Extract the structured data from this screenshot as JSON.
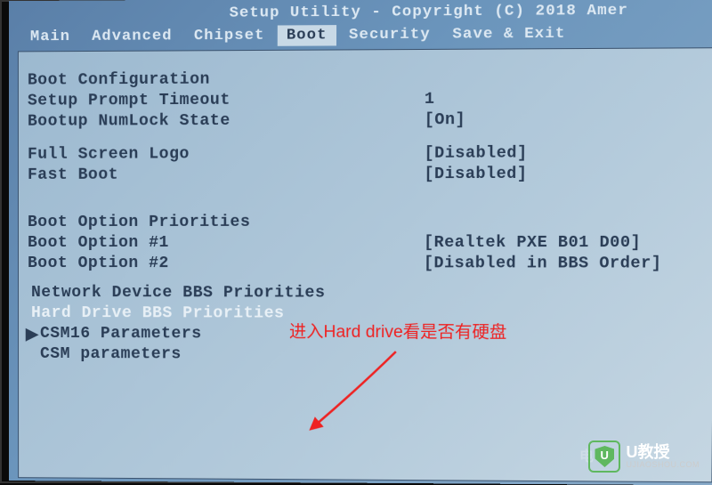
{
  "title_fragment": "Setup Utility - Copyright (C) 2018 Amer",
  "menu": {
    "items": [
      "Main",
      "Advanced",
      "Chipset",
      "Boot",
      "Security",
      "Save & Exit"
    ],
    "active_index": 3
  },
  "sections": {
    "boot_config": {
      "header": "Boot Configuration",
      "setup_prompt_label": "Setup Prompt Timeout",
      "setup_prompt_value": "1",
      "numlock_label": "Bootup NumLock State",
      "numlock_value": "[On]"
    },
    "display": {
      "full_screen_label": "Full Screen Logo",
      "full_screen_value": "[Disabled]",
      "fast_boot_label": "Fast Boot",
      "fast_boot_value": "[Disabled]"
    },
    "priorities": {
      "header": "Boot Option Priorities",
      "opt1_label": "Boot Option #1",
      "opt1_value": "[Realtek PXE B01 D00]",
      "opt2_label": "Boot Option #2",
      "opt2_value": "[Disabled in BBS Order]"
    },
    "sub_items": {
      "network": "Network Device BBS Priorities",
      "harddrive": "Hard Drive BBS Priorities",
      "csm16": "CSM16 Parameters",
      "csm": "CSM parameters"
    }
  },
  "selected_item": "harddrive",
  "cursor_char": "▶",
  "annotation_text": "进入Hard drive看是否有硬盘",
  "watermark": {
    "brand": "U教授",
    "sub": "UJIAOSHOU.COM",
    "faint": "电"
  }
}
